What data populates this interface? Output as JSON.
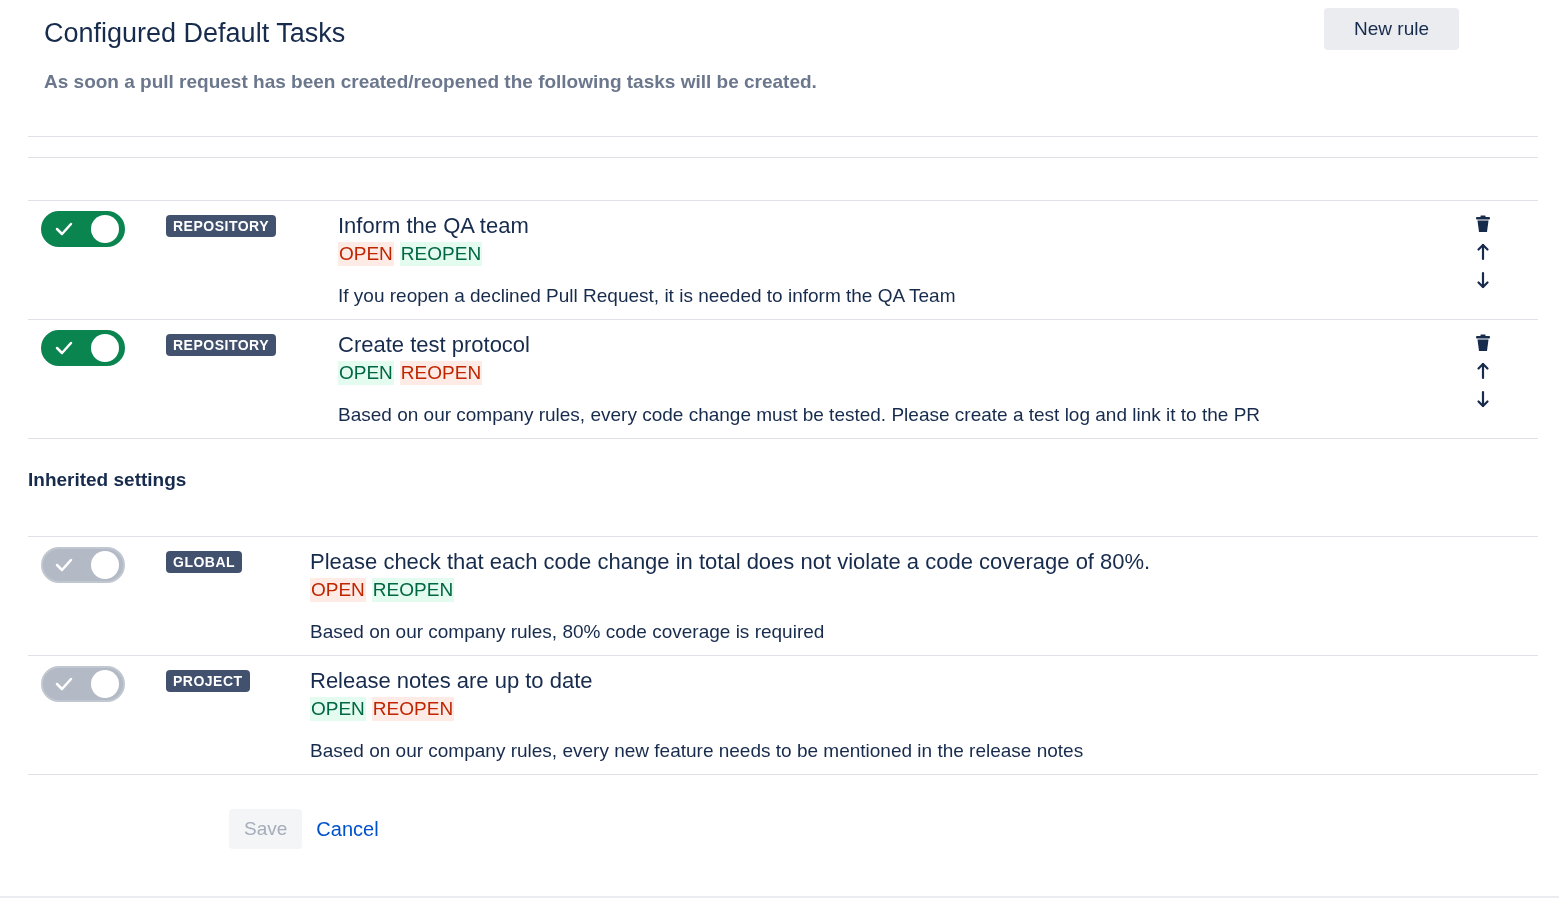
{
  "header": {
    "title": "Configured Default Tasks",
    "new_rule_button": "New rule",
    "description": "As soon a pull request has been created/reopened the following tasks will be created."
  },
  "rules": [
    {
      "on": true,
      "disabled": false,
      "scope": "REPOSITORY",
      "title": "Inform the QA team",
      "events": [
        {
          "label": "OPEN",
          "enabled": false
        },
        {
          "label": "REOPEN",
          "enabled": true
        }
      ],
      "description": "If you reopen a declined Pull Request, it is needed to inform the QA Team"
    },
    {
      "on": true,
      "disabled": false,
      "scope": "REPOSITORY",
      "title": "Create test protocol",
      "events": [
        {
          "label": "OPEN",
          "enabled": true
        },
        {
          "label": "REOPEN",
          "enabled": false
        }
      ],
      "description": "Based on our company rules, every code change must be tested. Please create a test log and link it to the PR"
    }
  ],
  "inherited": {
    "heading": "Inherited settings",
    "rules": [
      {
        "on": true,
        "disabled": true,
        "scope": "GLOBAL",
        "title": "Please check that each code change in total does not violate a code coverage of 80%.",
        "events": [
          {
            "label": "OPEN",
            "enabled": false
          },
          {
            "label": "REOPEN",
            "enabled": true
          }
        ],
        "description": "Based on our company rules, 80% code coverage is required"
      },
      {
        "on": true,
        "disabled": true,
        "scope": "PROJECT",
        "title": "Release notes are up to date",
        "events": [
          {
            "label": "OPEN",
            "enabled": true
          },
          {
            "label": "REOPEN",
            "enabled": false
          }
        ],
        "description": "Based on our company rules, every new feature needs to be mentioned in the release notes"
      }
    ]
  },
  "footer": {
    "save": {
      "label": "Save",
      "disabled": true
    },
    "cancel": "Cancel"
  }
}
